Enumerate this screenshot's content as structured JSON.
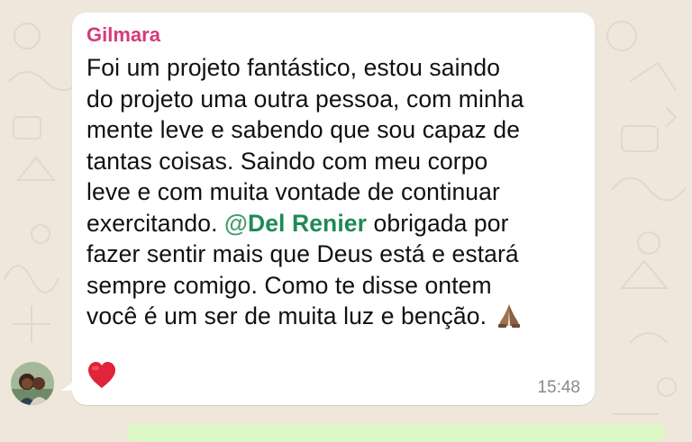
{
  "chat": {
    "message": {
      "sender": "Gilmara",
      "sender_color": "#d63a7b",
      "text_before_mention": [
        "Foi um projeto fantástico, estou saindo",
        "do projeto uma outra pessoa, com minha",
        "mente leve e sabendo que sou capaz de",
        "tantas coisas. Saindo com meu corpo",
        "leve e com muita vontade de continuar"
      ],
      "mention_line_prefix": "exercitando. ",
      "mention_at": "@",
      "mention_name": "Del Renier",
      "mention_at_color": "#4a9c6e",
      "mention_color": "#1f8a53",
      "mention_line_suffix": " obrigada por",
      "text_after_mention": [
        "fazer sentir mais que Deus está e estará",
        "sempre comigo. Como te disse ontem"
      ],
      "last_line": "você é um ser de muita luz e benção. ",
      "emoji_1": "folded-hands-emoji",
      "emoji_2": "red-heart-emoji",
      "time": "15:48"
    },
    "avatar": "avatar-photo",
    "colors": {
      "wallpaper": "#efe7dc",
      "bubble": "#ffffff",
      "outgoing_bubble": "#dcf7c5",
      "timestamp": "#8a8a8a"
    }
  }
}
